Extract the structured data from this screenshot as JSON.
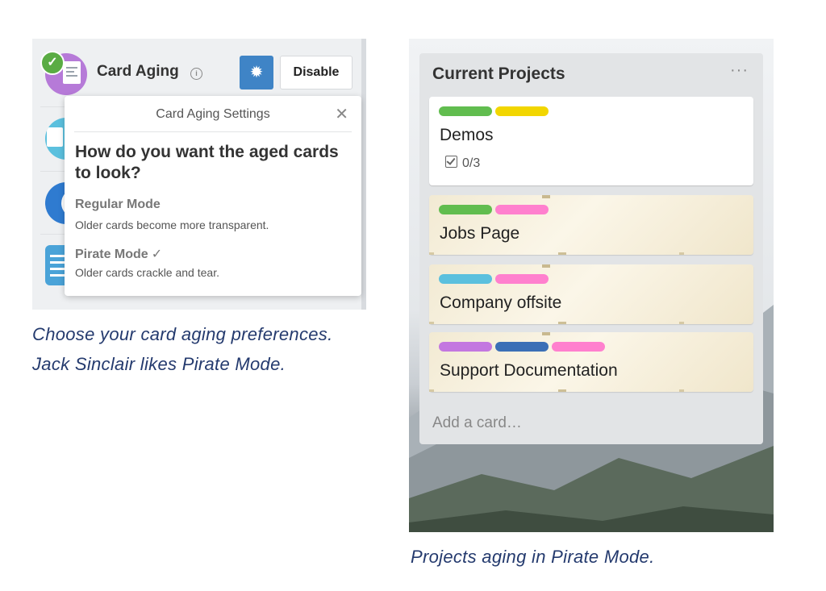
{
  "left_panel": {
    "plugin_title": "Card Aging",
    "info_icon": "info-circle-icon",
    "settings_icon": "gear-icon",
    "disable_label": "Disable",
    "popover": {
      "title": "Card Aging Settings",
      "close_icon": "close-icon",
      "question": "How do you want the aged cards to look?",
      "modes": [
        {
          "name": "Regular Mode",
          "description": "Older cards become more transparent.",
          "selected": false
        },
        {
          "name": "Pirate Mode",
          "description": "Older cards crackle and tear.",
          "selected": true,
          "check": "✓"
        }
      ]
    }
  },
  "captions": {
    "left_line1": "Choose your card aging preferences.",
    "left_line2": "Jack Sinclair likes Pirate Mode.",
    "right": "Projects aging in Pirate Mode."
  },
  "board": {
    "list_title": "Current Projects",
    "list_menu": "···",
    "cards": [
      {
        "title": "Demos",
        "labels": [
          "#61bd4f",
          "#f2d600"
        ],
        "checklist": "0/3",
        "aged": false
      },
      {
        "title": "Jobs Page",
        "labels": [
          "#61bd4f",
          "#ff80ce"
        ],
        "aged": true
      },
      {
        "title": "Company offsite",
        "labels": [
          "#5bc0de",
          "#ff80ce"
        ],
        "aged": true
      },
      {
        "title": "Support Documentation",
        "labels": [
          "#c377e0",
          "#3b6fb6",
          "#ff80ce"
        ],
        "aged": true
      }
    ],
    "add_card": "Add a card…"
  },
  "colors": {
    "accent_blue": "#3f84c6",
    "success_green": "#5aac44",
    "caption_navy": "#243a6e"
  }
}
